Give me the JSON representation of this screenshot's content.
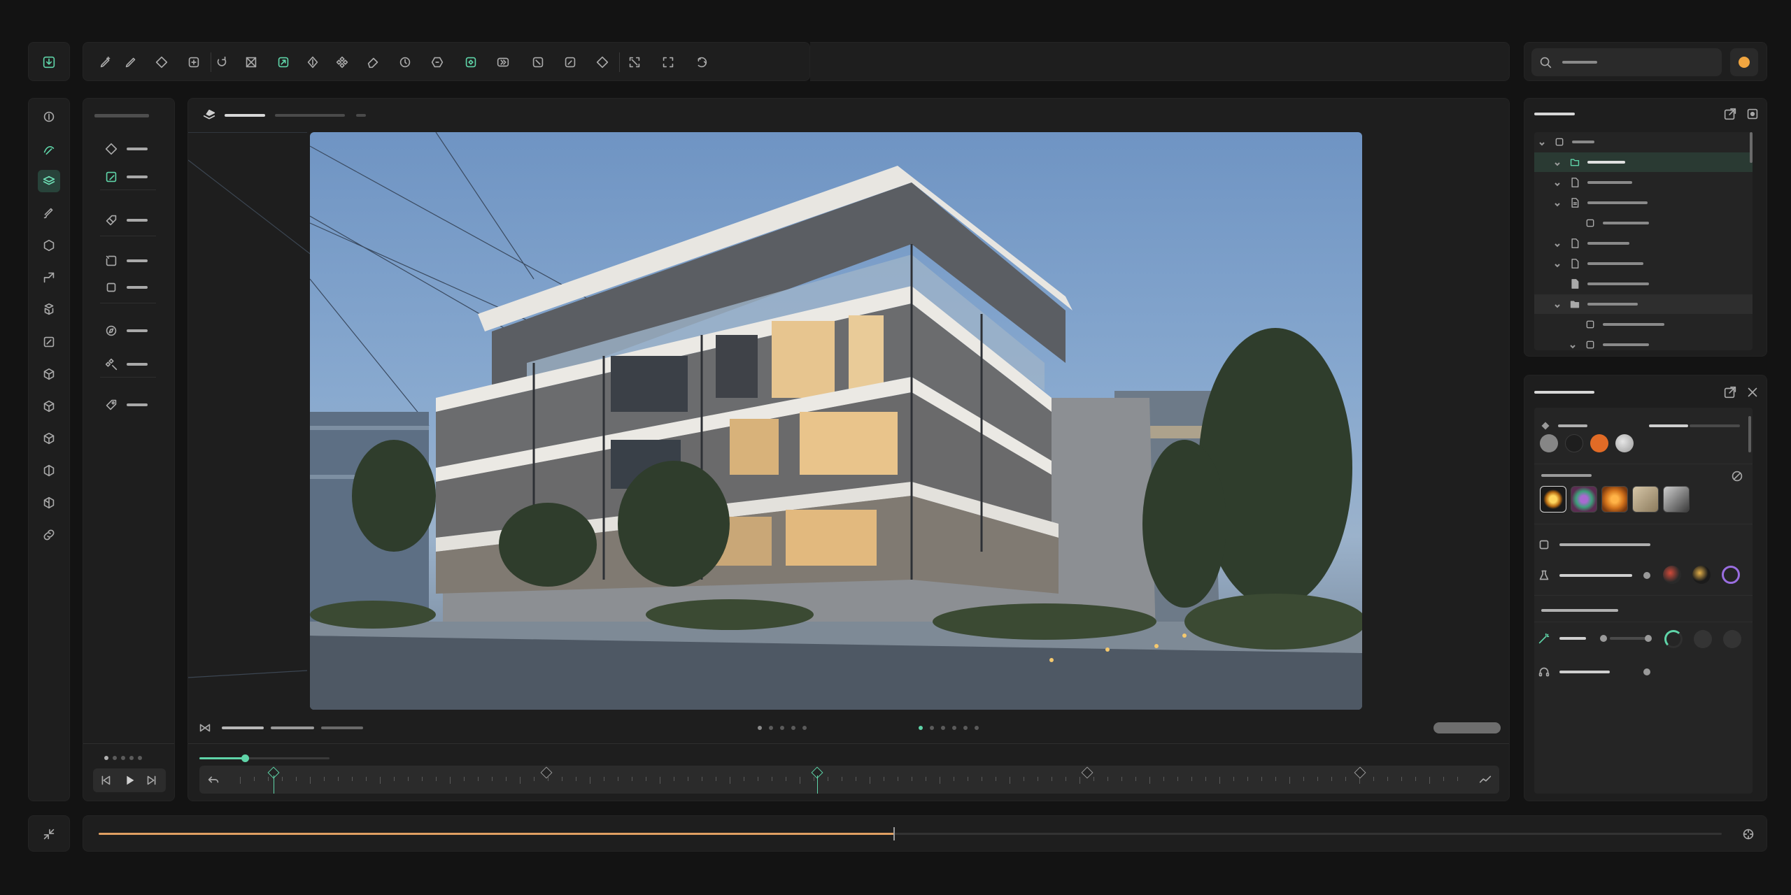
{
  "app": {
    "title": "",
    "accent": "#5fd4a8",
    "progress_color": "#e0a062"
  },
  "top_toolbar": {
    "tools": [
      "pen-plus-icon",
      "pencil-icon",
      "diamond-icon",
      "add-square-icon",
      "rotate-icon",
      "crop-x-icon",
      "transform-icon",
      "move-icon",
      "grid-move-icon",
      "erase-icon",
      "clock-icon",
      "shape-icon",
      "shape-active-icon",
      "forward-icon",
      "slash-square-icon",
      "pen-square-icon",
      "diamond-outline-icon",
      "expand-icon",
      "frame-icon",
      "refresh-icon"
    ]
  },
  "search": {
    "icon": "search-icon",
    "value": ""
  },
  "status": {
    "indicator_color": "#f0a540"
  },
  "left_toolbar": {
    "tools": [
      "info-icon",
      "pen-active-icon",
      "layers-icon",
      "brush-icon",
      "hexagon-icon",
      "scale-icon",
      "stack-icon",
      "edit-icon",
      "cube-icon",
      "cube-outline-icon",
      "box-icon",
      "half-hexagon-icon",
      "half-cube-icon",
      "link-icon"
    ]
  },
  "tool_list": {
    "items": [
      "diamond-icon",
      "pen-tool-icon",
      "tag-edit-icon",
      "square-rotate-icon",
      "square-icon",
      "compass-icon",
      "move-arrows-icon",
      "tag-icon"
    ]
  },
  "viewport": {
    "image": "modern-apartment-building-render",
    "page_dots": 5,
    "active_dot": 1
  },
  "timeline": {
    "scrubber_fraction": 0.35,
    "keyframes": [
      0.057,
      0.267,
      0.475,
      0.683,
      0.893
    ]
  },
  "scene_tree": {
    "rows": [
      {
        "level": 0,
        "icon": "square-icon",
        "expanded": true
      },
      {
        "level": 1,
        "icon": "folder-icon",
        "expanded": true,
        "active": true
      },
      {
        "level": 1,
        "icon": "file-icon",
        "expanded": true
      },
      {
        "level": 1,
        "icon": "doc-icon",
        "expanded": true
      },
      {
        "level": 2,
        "icon": "square-icon",
        "expanded": false
      },
      {
        "level": 1,
        "icon": "file-icon",
        "expanded": true
      },
      {
        "level": 1,
        "icon": "file-icon",
        "expanded": true
      },
      {
        "level": 1,
        "icon": "file-solid-icon",
        "expanded": false
      },
      {
        "level": 1,
        "icon": "folder-solid-icon",
        "expanded": true,
        "selected": true
      },
      {
        "level": 2,
        "icon": "square-icon",
        "expanded": false
      },
      {
        "level": 2,
        "icon": "square-icon",
        "expanded": true
      }
    ]
  },
  "properties": {
    "swatches": [
      "#868686",
      "#1e1e1e",
      "#e16b26",
      "#b8b8b8"
    ],
    "materials": [
      "sun-material",
      "plant-material",
      "warm-material",
      "gray-material",
      "cube-material"
    ]
  },
  "bottom_bar": {
    "progress_fraction": 0.49
  }
}
